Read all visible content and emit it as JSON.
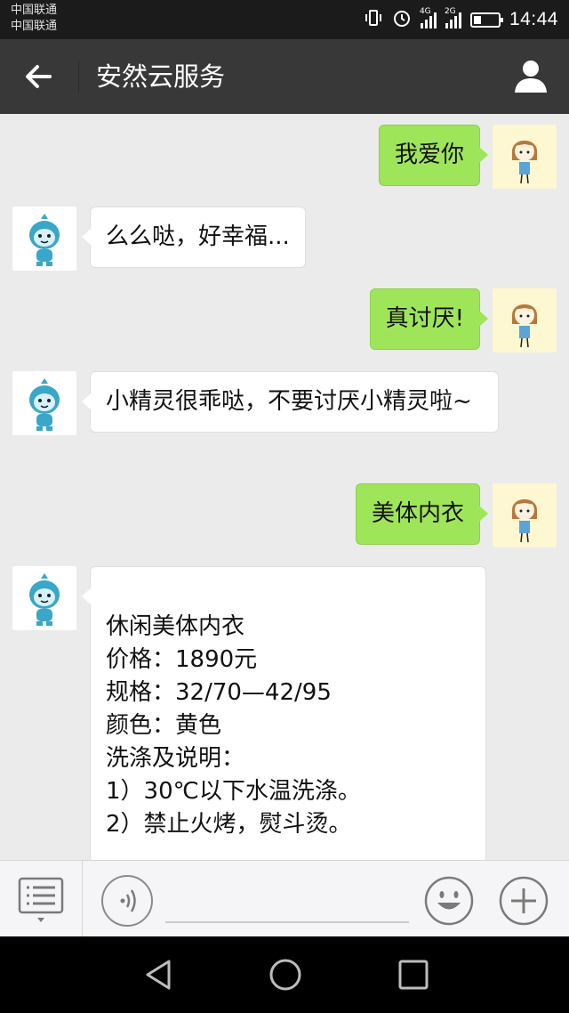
{
  "status": {
    "carrier1": "中国联通",
    "carrier2": "中国联通",
    "net1": "4G",
    "net2": "2G",
    "battery_level": 0.3,
    "time": "14:44"
  },
  "header": {
    "title": "安然云服务",
    "back_icon": "arrow-left-icon",
    "profile_icon": "person-icon"
  },
  "messages": [
    {
      "side": "me",
      "text": "我爱你"
    },
    {
      "side": "them",
      "text": "么么哒，好幸福..."
    },
    {
      "side": "me",
      "text": "真讨厌!"
    },
    {
      "side": "them",
      "text": "小精灵很乖哒，不要讨厌小精灵啦~"
    },
    {
      "side": "me",
      "text": "美体内衣"
    },
    {
      "side": "them",
      "text": "休闲美体内衣\n价格：1890元\n规格：32/70—42/95\n颜色：黄色\n洗涤及说明：\n1）30℃以下水温洗涤。\n2）禁止火烤，熨斗烫。\n\n以上答案是否解决了您的问题?"
    }
  ],
  "colors": {
    "my_bubble": "#9fe55a",
    "their_bubble": "#ffffff",
    "titlebar": "#383838",
    "chat_bg": "#ebebeb"
  },
  "input": {
    "value": "",
    "menu_icon": "list-menu-icon",
    "voice_icon": "voice-icon",
    "emoji_icon": "emoji-icon",
    "plus_icon": "plus-icon"
  },
  "nav": {
    "back_icon": "triangle-back-icon",
    "home_icon": "circle-home-icon",
    "recent_icon": "square-recent-icon"
  }
}
